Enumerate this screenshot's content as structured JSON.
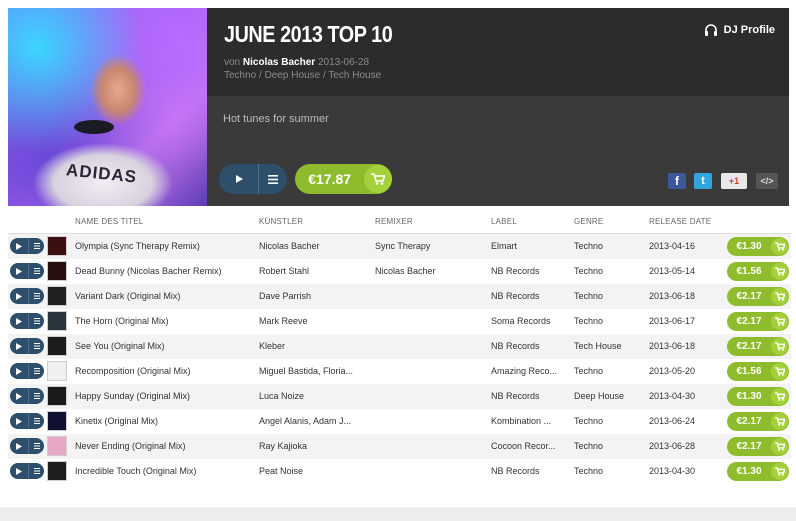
{
  "release": {
    "title": "JUNE 2013 TOP 10",
    "by_prefix": "von",
    "artist": "Nicolas Bacher",
    "date": "2013-06-28",
    "genres": "Techno / Deep House / Tech House",
    "description": "Hot tunes for summer",
    "price": "€17.87",
    "cover_text": "ADIDAS"
  },
  "dj_profile_label": "DJ Profile",
  "social": {
    "facebook": "f",
    "twitter": "t",
    "gplus": "+1",
    "embed": "</>"
  },
  "columns": {
    "title": "NAME DES TITEL",
    "artist": "KÜNSTLER",
    "remixer": "REMIXER",
    "label": "LABEL",
    "genre": "GENRE",
    "release_date": "RELEASE DATE"
  },
  "tracks": [
    {
      "title": "Olympia (Sync Therapy Remix)",
      "artist": "Nicolas Bacher",
      "remixer": "Sync Therapy",
      "label": "Elmart",
      "genre": "Techno",
      "date": "2013-04-16",
      "price": "€1.30"
    },
    {
      "title": "Dead Bunny (Nicolas Bacher Remix)",
      "artist": "Robert Stahl",
      "remixer": "Nicolas Bacher",
      "label": "NB Records",
      "genre": "Techno",
      "date": "2013-05-14",
      "price": "€1.56"
    },
    {
      "title": "Variant Dark (Original Mix)",
      "artist": "Dave Parrish",
      "remixer": "",
      "label": "NB Records",
      "genre": "Techno",
      "date": "2013-06-18",
      "price": "€2.17"
    },
    {
      "title": "The Horn (Original Mix)",
      "artist": "Mark Reeve",
      "remixer": "",
      "label": "Soma Records",
      "genre": "Techno",
      "date": "2013-06-17",
      "price": "€2.17"
    },
    {
      "title": "See You (Original Mix)",
      "artist": "Kleber",
      "remixer": "",
      "label": "NB Records",
      "genre": "Tech House",
      "date": "2013-06-18",
      "price": "€2.17"
    },
    {
      "title": "Recomposition (Original Mix)",
      "artist": "Miguel Bastida, Floria...",
      "remixer": "",
      "label": "Amazing Reco...",
      "genre": "Techno",
      "date": "2013-05-20",
      "price": "€1.56"
    },
    {
      "title": "Happy Sunday (Original Mix)",
      "artist": "Luca Noize",
      "remixer": "",
      "label": "NB Records",
      "genre": "Deep House",
      "date": "2013-04-30",
      "price": "€1.30"
    },
    {
      "title": "Kinetix (Original Mix)",
      "artist": "Angel Alanis, Adam J...",
      "remixer": "",
      "label": "Kombination ...",
      "genre": "Techno",
      "date": "2013-06-24",
      "price": "€2.17"
    },
    {
      "title": "Never Ending (Original Mix)",
      "artist": "Ray Kajioka",
      "remixer": "",
      "label": "Cocoon Recor...",
      "genre": "Techno",
      "date": "2013-06-28",
      "price": "€2.17"
    },
    {
      "title": "Incredible Touch (Original Mix)",
      "artist": "Peat Noise",
      "remixer": "",
      "label": "NB Records",
      "genre": "Techno",
      "date": "2013-04-30",
      "price": "€1.30"
    }
  ],
  "thumb_colors": [
    "#3a1010",
    "#2a0f0f",
    "#202020",
    "#2b3540",
    "#1c1c1c",
    "#f0f0f0",
    "#1a1a1a",
    "#101030",
    "#e9a7c7",
    "#1e1e1e"
  ],
  "colors": {
    "accent_green": "#8ebc2c",
    "player_blue": "#2d4f6b",
    "header_dark": "#2c2c2c"
  }
}
